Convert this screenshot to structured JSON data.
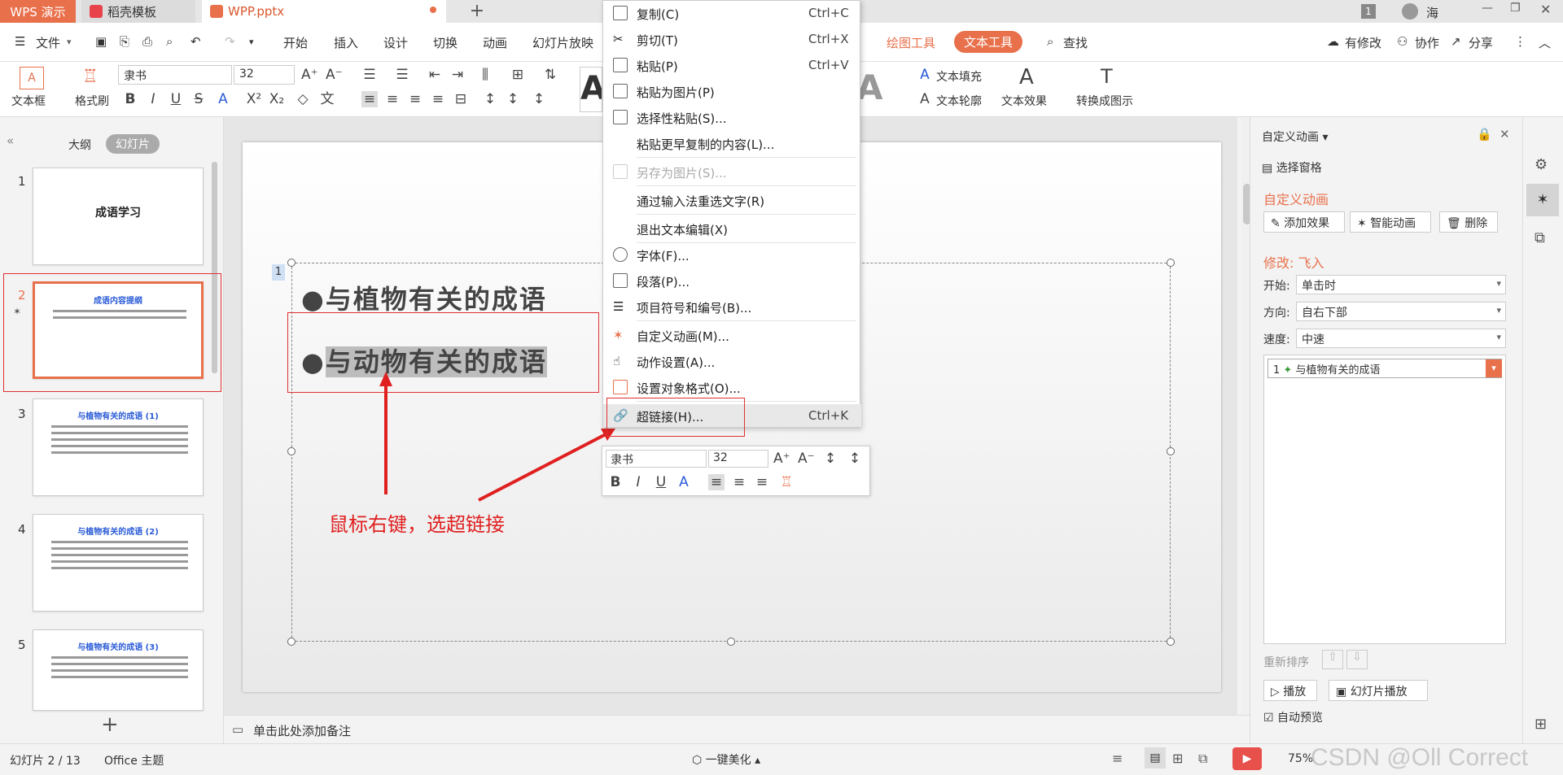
{
  "titlebar": {
    "tabs": [
      {
        "label": "WPS 演示"
      },
      {
        "label": "稻壳模板"
      },
      {
        "label": "WPP.pptx"
      }
    ],
    "badge": "1",
    "user": "海"
  },
  "menubar": {
    "file": "文件",
    "items": [
      "开始",
      "插入",
      "设计",
      "切换",
      "动画",
      "幻灯片放映"
    ],
    "drawing_tools": "绘图工具",
    "text_tools": "文本工具",
    "search": "查找",
    "modified": "有修改",
    "collaborate": "协作",
    "share": "分享"
  },
  "ribbon": {
    "textbox": "文本框",
    "format_painter": "格式刷",
    "font": "隶书",
    "size": "32",
    "fill": "文本填充",
    "outline": "文本轮廓",
    "effect": "文本效果",
    "convert": "转换成图示"
  },
  "leftpanel": {
    "tabs": [
      "大纲",
      "幻灯片"
    ],
    "slides": [
      {
        "num": "1",
        "title": "成语学习"
      },
      {
        "num": "2",
        "title": "成语内容提纲"
      },
      {
        "num": "3",
        "title": "与植物有关的成语 (1)"
      },
      {
        "num": "4",
        "title": "与植物有关的成语 (2)"
      },
      {
        "num": "5",
        "title": "与植物有关的成语 (3)"
      }
    ]
  },
  "slide": {
    "badge": "1",
    "bullet1": "与植物有关的成语",
    "bullet2": "与动物有关的成语",
    "annotation": "鼠标右键，选超链接"
  },
  "context_menu": {
    "items": [
      {
        "label": "复制(C)",
        "shortcut": "Ctrl+C"
      },
      {
        "label": "剪切(T)",
        "shortcut": "Ctrl+X"
      },
      {
        "label": "粘贴(P)",
        "shortcut": "Ctrl+V"
      },
      {
        "label": "粘贴为图片(P)",
        "shortcut": ""
      },
      {
        "label": "选择性粘贴(S)...",
        "shortcut": ""
      },
      {
        "label": "粘贴更早复制的内容(L)...",
        "shortcut": ""
      },
      {
        "label": "另存为图片(S)...",
        "shortcut": ""
      },
      {
        "label": "通过输入法重选文字(R)",
        "shortcut": ""
      },
      {
        "label": "退出文本编辑(X)",
        "shortcut": ""
      },
      {
        "label": "字体(F)...",
        "shortcut": ""
      },
      {
        "label": "段落(P)...",
        "shortcut": ""
      },
      {
        "label": "项目符号和编号(B)...",
        "shortcut": ""
      },
      {
        "label": "自定义动画(M)...",
        "shortcut": ""
      },
      {
        "label": "动作设置(A)...",
        "shortcut": ""
      },
      {
        "label": "设置对象格式(O)...",
        "shortcut": ""
      },
      {
        "label": "超链接(H)...",
        "shortcut": "Ctrl+K"
      }
    ]
  },
  "mini_toolbar": {
    "font": "隶书",
    "size": "32"
  },
  "rightpanel": {
    "header": "自定义动画",
    "select_pane": "选择窗格",
    "section": "自定义动画",
    "add_effect": "添加效果",
    "smart_anim": "智能动画",
    "delete": "删除",
    "modify": "修改: 飞入",
    "start_label": "开始:",
    "start_value": "单击时",
    "dir_label": "方向:",
    "dir_value": "自右下部",
    "speed_label": "速度:",
    "speed_value": "中速",
    "list_item_num": "1",
    "list_item": "与植物有关的成语",
    "reorder": "重新排序",
    "play": "播放",
    "slideshow": "幻灯片播放",
    "autopreview": "自动预览"
  },
  "notes": "单击此处添加备注",
  "statusbar": {
    "slide_info": "幻灯片 2 / 13",
    "theme": "Office 主题",
    "beautify": "一键美化",
    "zoom": "75%",
    "watermark": "CSDN @Oll Correct"
  }
}
